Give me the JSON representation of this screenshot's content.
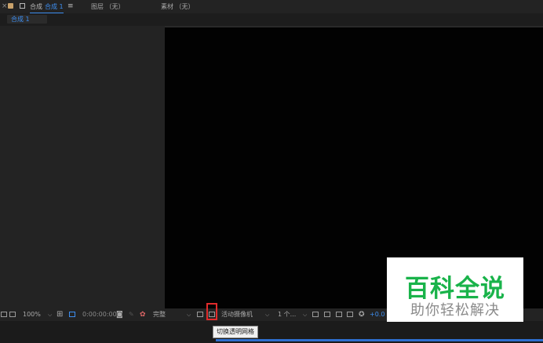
{
  "tabs": {
    "comp_prefix": "合成",
    "comp_active": "合成 1",
    "layer": "图层 （无）",
    "footage": "素材 （无）"
  },
  "breadcrumb": {
    "label": "合成 1"
  },
  "toolbar": {
    "zoom": "100%",
    "timecode": "0:00:00:00",
    "resolution": "完整",
    "camera": "活动摄像机",
    "views": "1 个...",
    "exposure": "+0.0"
  },
  "tooltip": "切换透明网格",
  "watermark": {
    "title": "百科全说",
    "subtitle": "助你轻松解决"
  },
  "colors": {
    "accent": "#3d8ef0",
    "highlight": "#e02b2b",
    "watermark_green": "#19b34a"
  }
}
